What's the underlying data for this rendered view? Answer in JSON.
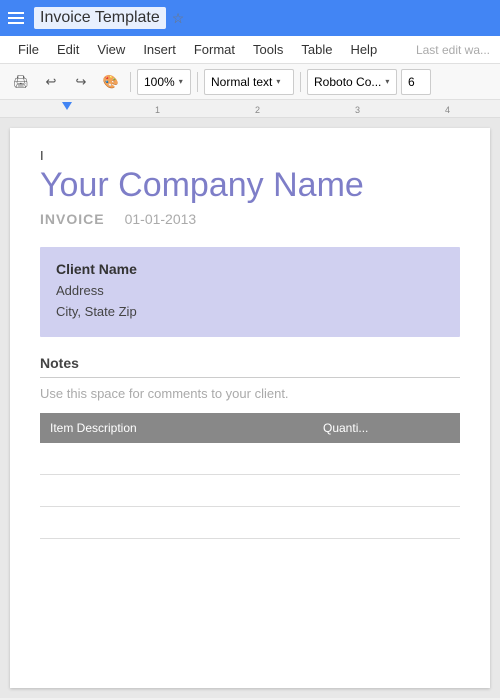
{
  "topbar": {
    "doc_title": "Invoice Template",
    "star_label": "☆"
  },
  "menubar": {
    "items": [
      "File",
      "Edit",
      "View",
      "Insert",
      "Format",
      "Tools",
      "Table",
      "Help"
    ],
    "last_edit": "Last edit wa..."
  },
  "toolbar": {
    "zoom": "100%",
    "style": "Normal text",
    "font": "Roboto Co...",
    "size": "6",
    "zoom_arrow": "▾",
    "style_arrow": "▾",
    "font_arrow": "▾"
  },
  "document": {
    "cursor": "I",
    "company_name": "Your Company Name",
    "invoice_label": "INVOICE",
    "invoice_date": "01-01-2013",
    "client": {
      "name": "Client Name",
      "address": "Address",
      "city_state_zip": "City, State Zip"
    },
    "notes": {
      "title": "Notes",
      "placeholder": "Use this space for comments to your client."
    },
    "table": {
      "headers": [
        "Item Description",
        "Quanti..."
      ],
      "rows": [
        [
          "",
          ""
        ],
        [
          "",
          ""
        ],
        [
          "",
          ""
        ]
      ]
    }
  }
}
